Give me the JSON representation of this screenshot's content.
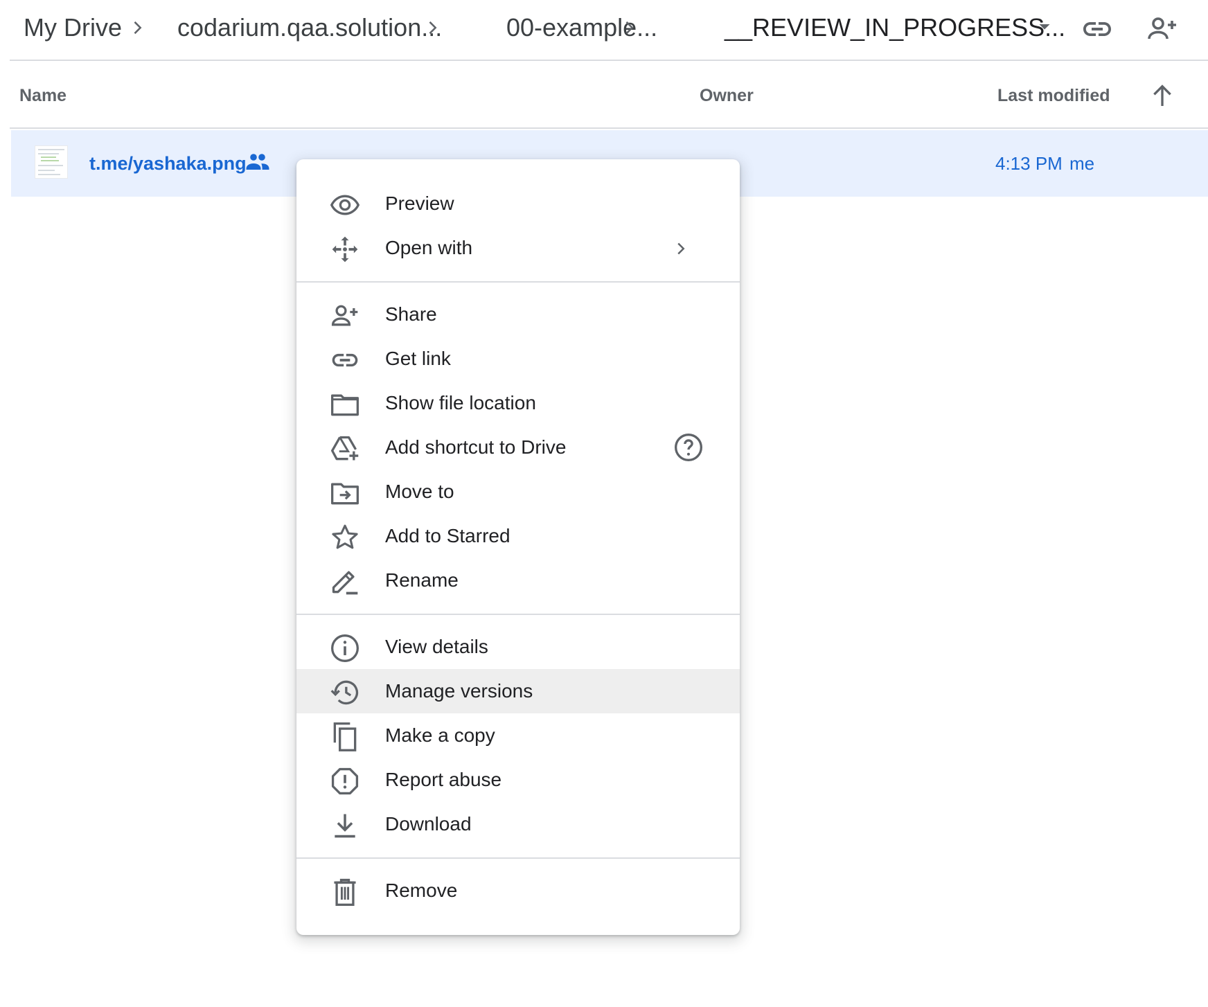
{
  "breadcrumb": {
    "items": [
      "My Drive",
      "codarium.qaa.solution...",
      "00-example...",
      "__REVIEW_IN_PROGRESS..."
    ]
  },
  "header_icons": [
    "dropdown-icon",
    "link-icon",
    "add-person-icon"
  ],
  "columns": {
    "name": "Name",
    "owner": "Owner",
    "last_modified": "Last modified"
  },
  "file": {
    "name": "t.me/yashaka.png",
    "modified_time": "4:13 PM",
    "modified_by": "me"
  },
  "menu": {
    "items": [
      {
        "label": "Preview",
        "icon": "eye-icon"
      },
      {
        "label": "Open with",
        "icon": "move-arrows-icon"
      },
      {
        "label": "Share",
        "icon": "add-person-icon"
      },
      {
        "label": "Get link",
        "icon": "link-icon"
      },
      {
        "label": "Show file location",
        "icon": "folder-icon"
      },
      {
        "label": "Add shortcut to Drive",
        "icon": "drive-shortcut-icon"
      },
      {
        "label": "Move to",
        "icon": "folder-move-icon"
      },
      {
        "label": "Add to Starred",
        "icon": "star-icon"
      },
      {
        "label": "Rename",
        "icon": "pencil-icon"
      },
      {
        "label": "View details",
        "icon": "info-icon"
      },
      {
        "label": "Manage versions",
        "icon": "history-icon"
      },
      {
        "label": "Make a copy",
        "icon": "copy-icon"
      },
      {
        "label": "Report abuse",
        "icon": "report-icon"
      },
      {
        "label": "Download",
        "icon": "download-icon"
      },
      {
        "label": "Remove",
        "icon": "trash-icon"
      }
    ],
    "hovered_item": "Manage versions"
  },
  "colors": {
    "selected_row_bg": "#e8f0fe",
    "link_blue": "#1967d2",
    "hover_bg": "#eeeeee",
    "icon_gray": "#5f6368",
    "divider": "#dadce0"
  }
}
